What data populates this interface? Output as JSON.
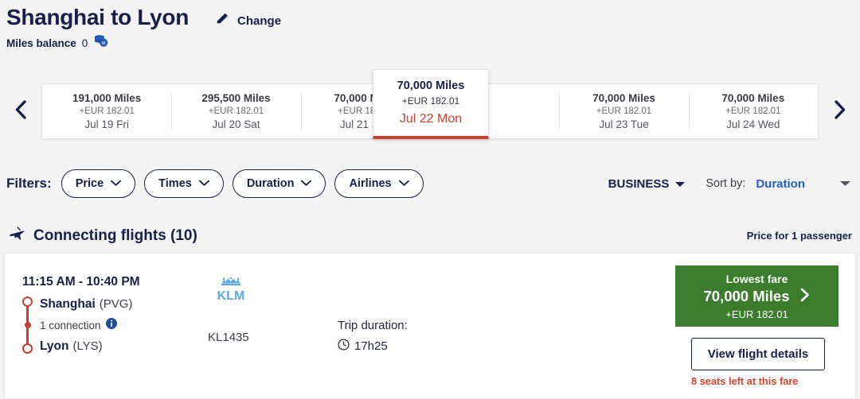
{
  "header": {
    "route_title": "Shanghai to Lyon",
    "change_label": "Change",
    "change_icon": "pencil-icon",
    "miles_balance_label": "Miles balance",
    "miles_balance_value": "0",
    "miles_icon": "coin-stack-icon"
  },
  "carousel": {
    "prev_icon": "chevron-left-icon",
    "next_icon": "chevron-right-icon",
    "days": [
      {
        "miles": "191,000 Miles",
        "price": "+EUR 182.01",
        "date": "Jul 19 Fri",
        "selected": false
      },
      {
        "miles": "295,500 Miles",
        "price": "+EUR 182.01",
        "date": "Jul 20 Sat",
        "selected": false
      },
      {
        "miles": "70,000 Miles",
        "price": "+EUR 182.01",
        "date": "Jul 21 Sun",
        "selected": false
      },
      {
        "miles": "70,000 Miles",
        "price": "+EUR 182.01",
        "date": "Jul 22 Mon",
        "selected": true
      },
      {
        "miles": "70,000 Miles",
        "price": "+EUR 182.01",
        "date": "Jul 23 Tue",
        "selected": false
      },
      {
        "miles": "70,000 Miles",
        "price": "+EUR 182.01",
        "date": "Jul 24 Wed",
        "selected": false
      }
    ]
  },
  "filters": {
    "label": "Filters:",
    "pills": [
      {
        "label": "Price"
      },
      {
        "label": "Times"
      },
      {
        "label": "Duration"
      },
      {
        "label": "Airlines"
      }
    ],
    "cabin_class": "BUSINESS",
    "sort_by_label": "Sort by:",
    "sort_by_value": "Duration"
  },
  "section": {
    "icon": "plane-icon",
    "title": "Connecting flights (10)",
    "passenger_note": "Price for 1 passenger"
  },
  "flight": {
    "times": "11:15 AM - 10:40 PM",
    "origin_city": "Shanghai",
    "origin_code": "(PVG)",
    "connections": "1 connection",
    "connection_info_icon": "info-icon",
    "destination_city": "Lyon",
    "destination_code": "(LYS)",
    "airline_logo": "klm-logo",
    "airline_name": "KLM",
    "flight_number": "KL1435",
    "duration_label": "Trip duration:",
    "duration_icon": "clock-icon",
    "duration_value": "17h25",
    "fare_badge": "Lowest fare",
    "fare_miles": "70,000 Miles",
    "fare_arrow_icon": "chevron-right-icon",
    "fare_taxes": "+EUR 182.01",
    "details_button": "View flight details",
    "seats_note": "8 seats left at this fare"
  },
  "colors": {
    "navy": "#15204b",
    "red": "#c8402d",
    "green": "#3b7d2c",
    "blue_link": "#1f5fd0",
    "klm_blue": "#5aa9e6",
    "page_bg": "#f4f4f4"
  }
}
